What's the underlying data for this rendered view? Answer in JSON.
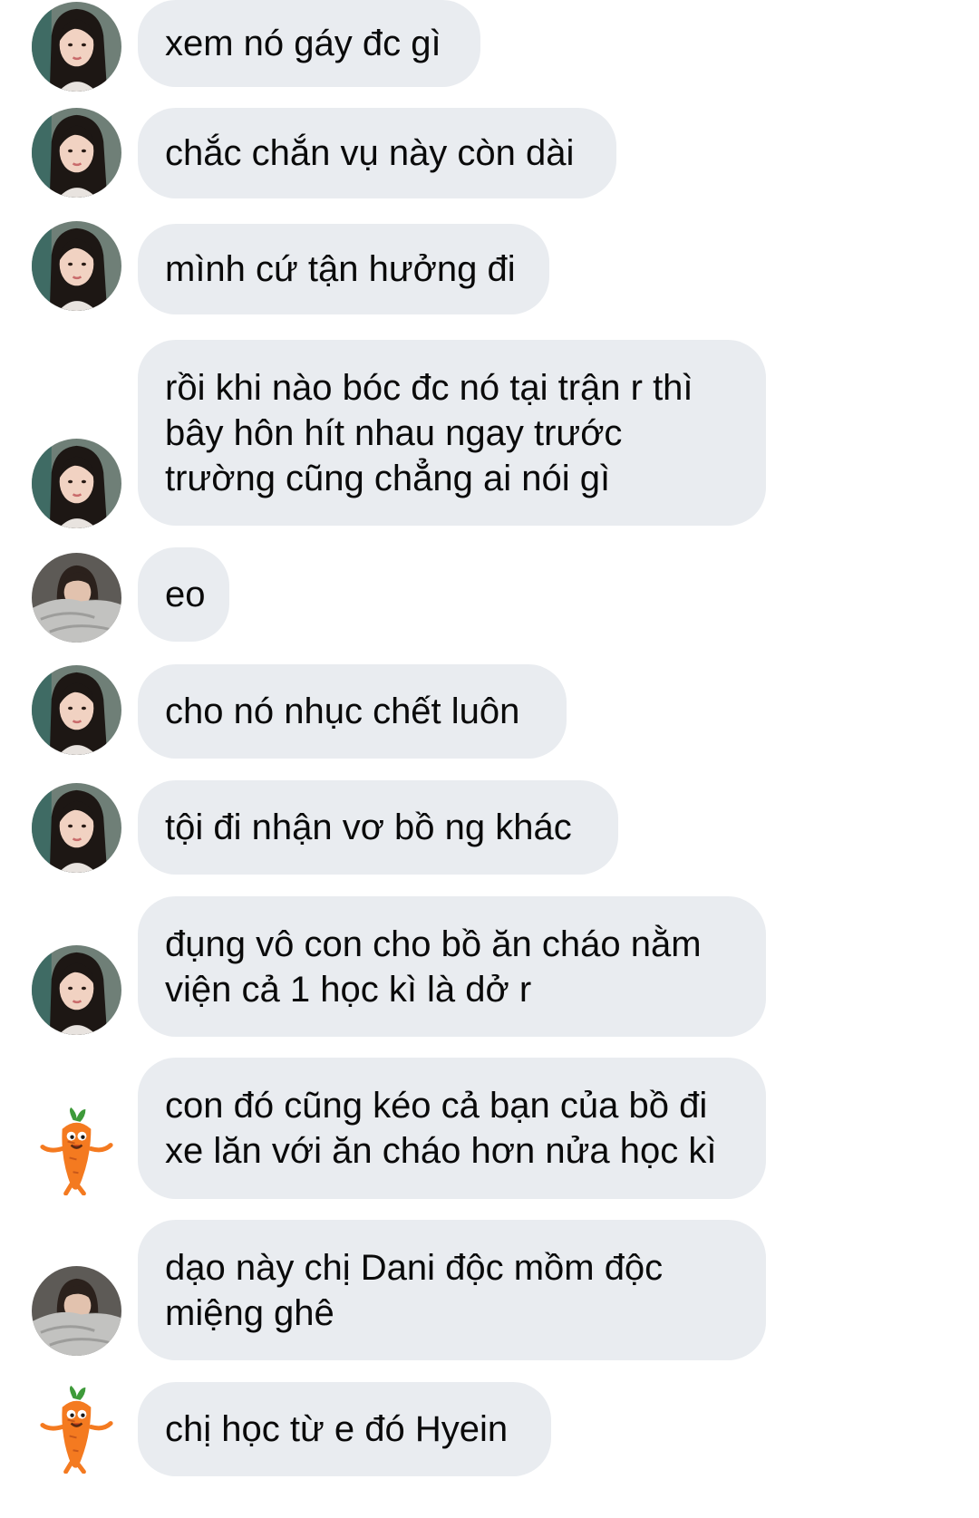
{
  "conversation": {
    "messages": [
      {
        "sender": "girl",
        "avatar_icon": "long-hair-girl-avatar-icon",
        "text": "xem nó gáy đc gì"
      },
      {
        "sender": "girl",
        "avatar_icon": "long-hair-girl-avatar-icon",
        "text": "chắc chắn vụ này còn dài"
      },
      {
        "sender": "girl",
        "avatar_icon": "long-hair-girl-avatar-icon",
        "text": "mình cứ tận hưởng đi"
      },
      {
        "sender": "girl",
        "avatar_icon": "long-hair-girl-avatar-icon",
        "text": "rồi khi nào bóc đc nó tại trận r thì\nbây hôn hít nhau ngay trước\ntrường cũng chẳng ai nói gì"
      },
      {
        "sender": "blanket",
        "avatar_icon": "blanket-selfie-avatar-icon",
        "text": "eo"
      },
      {
        "sender": "girl",
        "avatar_icon": "long-hair-girl-avatar-icon",
        "text": "cho nó nhục chết luôn"
      },
      {
        "sender": "girl",
        "avatar_icon": "long-hair-girl-avatar-icon",
        "text": "tội đi nhận vơ bồ ng khác"
      },
      {
        "sender": "girl",
        "avatar_icon": "long-hair-girl-avatar-icon",
        "text": "đụng vô con cho bồ ăn cháo nằm\nviện cả 1 học kì là dở r"
      },
      {
        "sender": "carrot",
        "avatar_icon": "carrot-sticker-avatar-icon",
        "text": "con đó cũng kéo cả bạn của bồ đi\nxe lăn với ăn cháo hơn nửa học kì"
      },
      {
        "sender": "blanket",
        "avatar_icon": "blanket-selfie-avatar-icon",
        "text": "dạo này chị Dani độc mồm độc\nmiệng ghê"
      },
      {
        "sender": "carrot",
        "avatar_icon": "carrot-sticker-avatar-icon",
        "text": "chị học từ e đó Hyein"
      }
    ]
  },
  "colors": {
    "bubble_background": "#e9ecf0",
    "text": "#0a0a0a",
    "page_background": "#ffffff"
  }
}
